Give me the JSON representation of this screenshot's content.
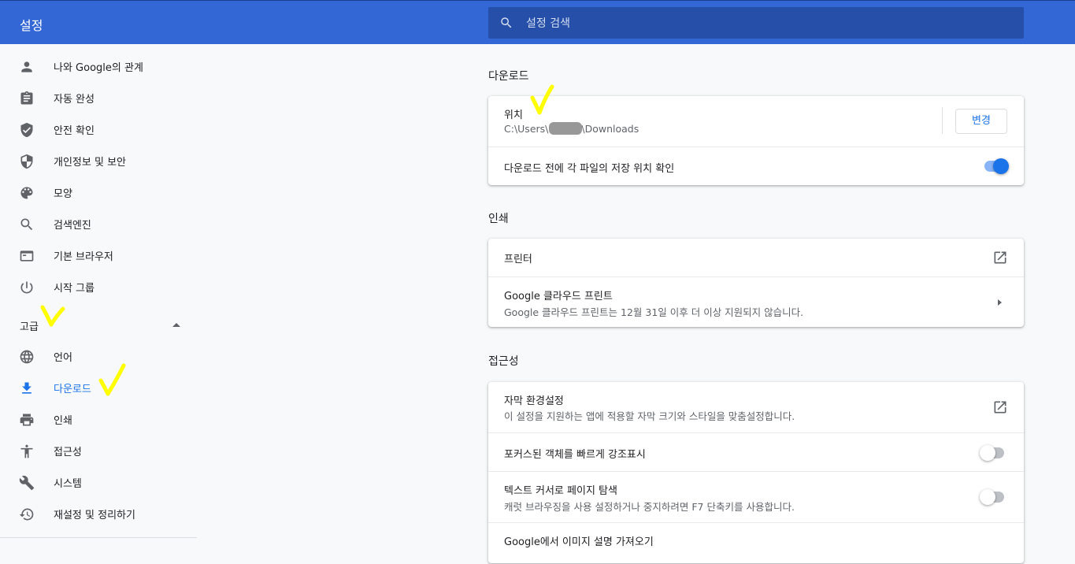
{
  "header": {
    "title": "설정",
    "search_placeholder": "설정 검색"
  },
  "sidebar": {
    "items": [
      {
        "label": "나와 Google의 관계",
        "icon": "person-icon"
      },
      {
        "label": "자동 완성",
        "icon": "clipboard-icon"
      },
      {
        "label": "안전 확인",
        "icon": "shield-check-icon"
      },
      {
        "label": "개인정보 및 보안",
        "icon": "shield-icon"
      },
      {
        "label": "모양",
        "icon": "palette-icon"
      },
      {
        "label": "검색엔진",
        "icon": "search-icon"
      },
      {
        "label": "기본 브라우저",
        "icon": "browser-window-icon"
      },
      {
        "label": "시작 그룹",
        "icon": "power-icon"
      }
    ],
    "advanced_label": "고급",
    "advanced_items": [
      {
        "label": "언어",
        "icon": "globe-icon"
      },
      {
        "label": "다운로드",
        "icon": "download-icon",
        "active": true
      },
      {
        "label": "인쇄",
        "icon": "printer-icon"
      },
      {
        "label": "접근성",
        "icon": "accessibility-icon"
      },
      {
        "label": "시스템",
        "icon": "wrench-icon"
      },
      {
        "label": "재설정 및 정리하기",
        "icon": "history-icon"
      }
    ]
  },
  "downloads": {
    "section_title": "다운로드",
    "location_label": "위치",
    "location_path_prefix": "C:\\Users\\",
    "location_path_suffix": "\\Downloads",
    "change_button": "변경",
    "ask_label": "다운로드 전에 각 파일의 저장 위치 확인",
    "ask_enabled": true
  },
  "printing": {
    "section_title": "인쇄",
    "printers_label": "프린터",
    "cloud_print_label": "Google 클라우드 프린트",
    "cloud_print_sub": "Google 클라우드 프린트는 12월 31일 이후 더 이상 지원되지 않습니다."
  },
  "accessibility": {
    "section_title": "접근성",
    "captions_label": "자막 환경설정",
    "captions_sub": "이 설정을 지원하는 앱에 적용할 자막 크기와 스타일을 맞춤설정합니다.",
    "focus_label": "포커스된 객체를 빠르게 강조표시",
    "focus_enabled": false,
    "caret_label": "텍스트 커서로 페이지 탐색",
    "caret_sub": "캐럿 브라우징을 사용 설정하거나 중지하려면 F7 단축키를 사용합니다.",
    "caret_enabled": false,
    "image_desc_label": "Google에서 이미지 설명 가져오기"
  },
  "colors": {
    "header_bg": "#3367d6",
    "accent": "#1a73e8",
    "annotation": "#ffff00"
  }
}
